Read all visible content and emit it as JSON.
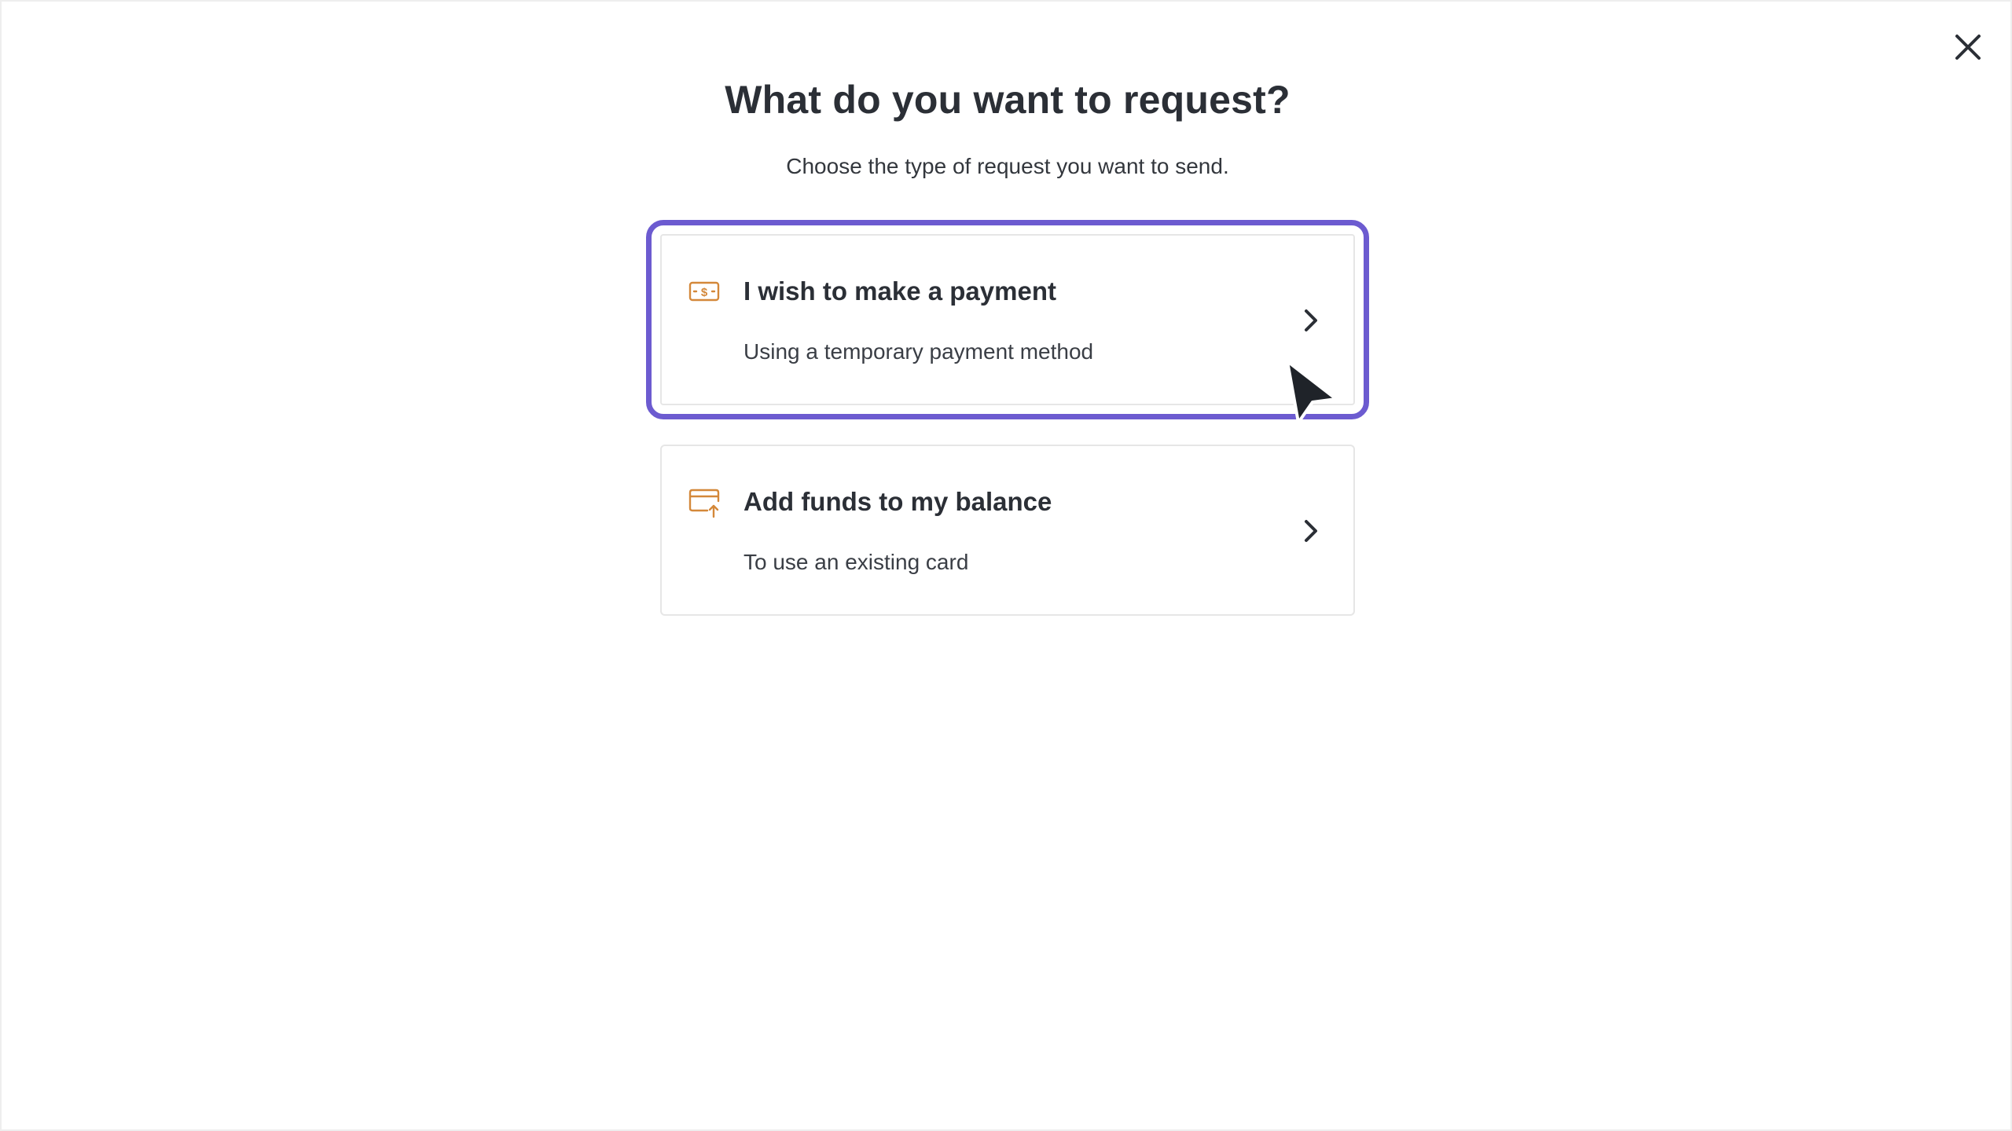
{
  "dialog": {
    "title": "What do you want to request?",
    "subtitle": "Choose the type of request you want to send."
  },
  "options": [
    {
      "title": "I wish to make a payment",
      "description": "Using a temporary payment method",
      "icon": "dollar-bill-icon",
      "focused": true
    },
    {
      "title": "Add funds to my balance",
      "description": "To use an existing card",
      "icon": "card-add-icon",
      "focused": false
    }
  ],
  "icons": {
    "close": "close-icon",
    "chevron": "chevron-right-icon",
    "cursor": "mouse-pointer-icon"
  },
  "colors": {
    "focus_ring": "#6c5bd0",
    "icon_accent": "#d4883a",
    "text_primary": "#2b2f36"
  }
}
